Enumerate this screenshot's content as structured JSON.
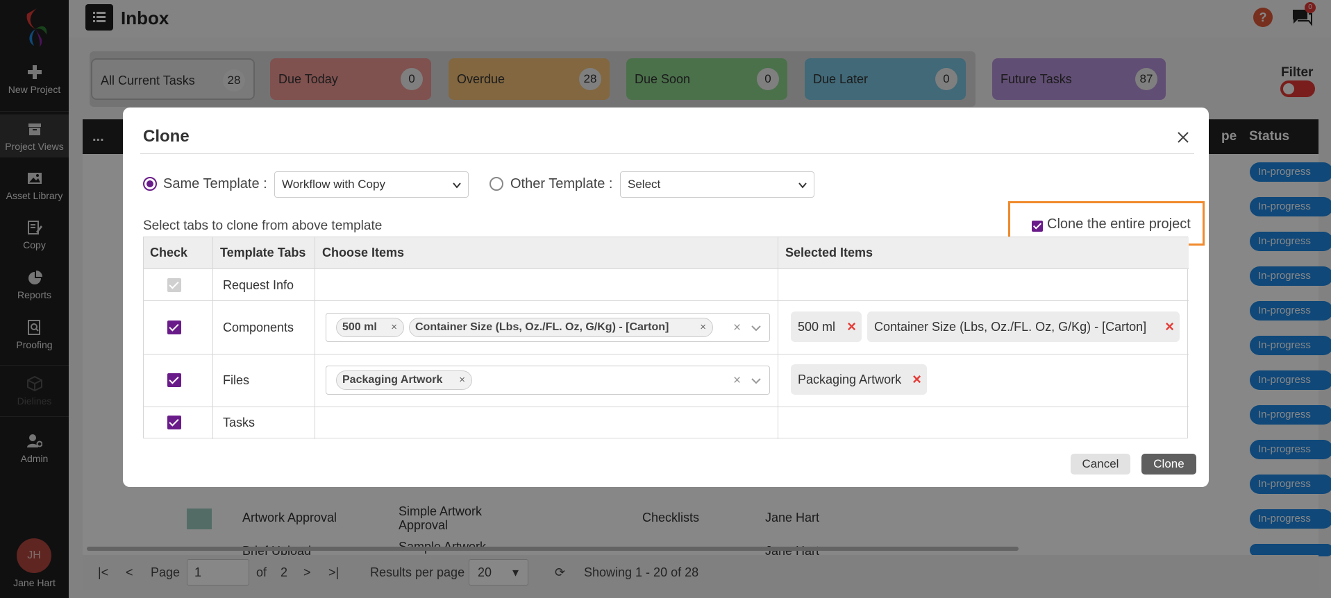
{
  "colors": {
    "brand_purple": "#6a1b8a",
    "highlight_orange": "#f08a2c",
    "status_blue": "#1e88e5",
    "remove_red": "#e53935"
  },
  "sidebar": {
    "items": [
      {
        "label": "New Project",
        "icon": "plus-icon"
      },
      {
        "label": "Project Views",
        "icon": "archive-icon"
      },
      {
        "label": "Asset Library",
        "icon": "image-icon"
      },
      {
        "label": "Copy",
        "icon": "edit-icon"
      },
      {
        "label": "Reports",
        "icon": "pie-chart-icon"
      },
      {
        "label": "Proofing",
        "icon": "search-doc-icon"
      },
      {
        "label": "Dielines",
        "icon": "cube-icon"
      },
      {
        "label": "Admin",
        "icon": "user-gear-icon"
      }
    ],
    "user": {
      "initials": "JH",
      "name": "Jane Hart"
    }
  },
  "header": {
    "title": "Inbox",
    "help": "?",
    "chat_badge": "0"
  },
  "status_tabs": [
    {
      "label": "All Current Tasks",
      "count": "28",
      "color": "#e6e6e6"
    },
    {
      "label": "Due Today",
      "count": "0",
      "color": "#f09a95"
    },
    {
      "label": "Overdue",
      "count": "28",
      "color": "#f5c27a"
    },
    {
      "label": "Due Soon",
      "count": "0",
      "color": "#8fd68f"
    },
    {
      "label": "Due Later",
      "count": "0",
      "color": "#7cc6e2"
    },
    {
      "label": "Future Tasks",
      "count": "87",
      "color": "#b793dc"
    }
  ],
  "filter": {
    "label": "Filter"
  },
  "background_table": {
    "dots": "...",
    "partial_col": "pe",
    "status_header": "Status",
    "status_value": "In-progress",
    "rows": [
      {
        "task": "Artwork Approval",
        "workflow_line1": "Simple Artwork",
        "workflow_line2": "Approval",
        "tab": "Checklists",
        "owner": "Jane Hart"
      },
      {
        "task": "Brief Upload",
        "workflow_line1": "Sample Artwork",
        "owner": "Jane Hart"
      }
    ]
  },
  "pager": {
    "page_label": "Page",
    "page_value": "1",
    "of_label": "of",
    "total_pages": "2",
    "results_label": "Results per page",
    "results_value": "20",
    "showing": "Showing 1 - 20 of 28"
  },
  "modal": {
    "title": "Clone",
    "same_template_label": "Same Template :",
    "same_template_value": "Workflow with Copy",
    "other_template_label": "Other Template :",
    "other_template_value": "Select",
    "select_tabs_label": "Select tabs to clone from above template",
    "clone_entire_label": "Clone the entire project",
    "table": {
      "headers": {
        "check": "Check",
        "tabs": "Template Tabs",
        "choose": "Choose Items",
        "selected": "Selected Items"
      },
      "rows": [
        {
          "tab": "Request Info",
          "checked": true,
          "disabled": true,
          "choose": [],
          "selected": []
        },
        {
          "tab": "Components",
          "checked": true,
          "choose": [
            "500 ml",
            "Container Size (Lbs, Oz./FL. Oz, G/Kg) - [Carton]"
          ],
          "selected": [
            "500 ml",
            "Container Size (Lbs, Oz./FL. Oz, G/Kg) - [Carton]"
          ]
        },
        {
          "tab": "Files",
          "checked": true,
          "choose": [
            "Packaging Artwork"
          ],
          "selected": [
            "Packaging Artwork"
          ]
        },
        {
          "tab": "Tasks",
          "checked": true,
          "choose": [],
          "selected": []
        }
      ]
    },
    "cancel_label": "Cancel",
    "clone_label": "Clone"
  }
}
